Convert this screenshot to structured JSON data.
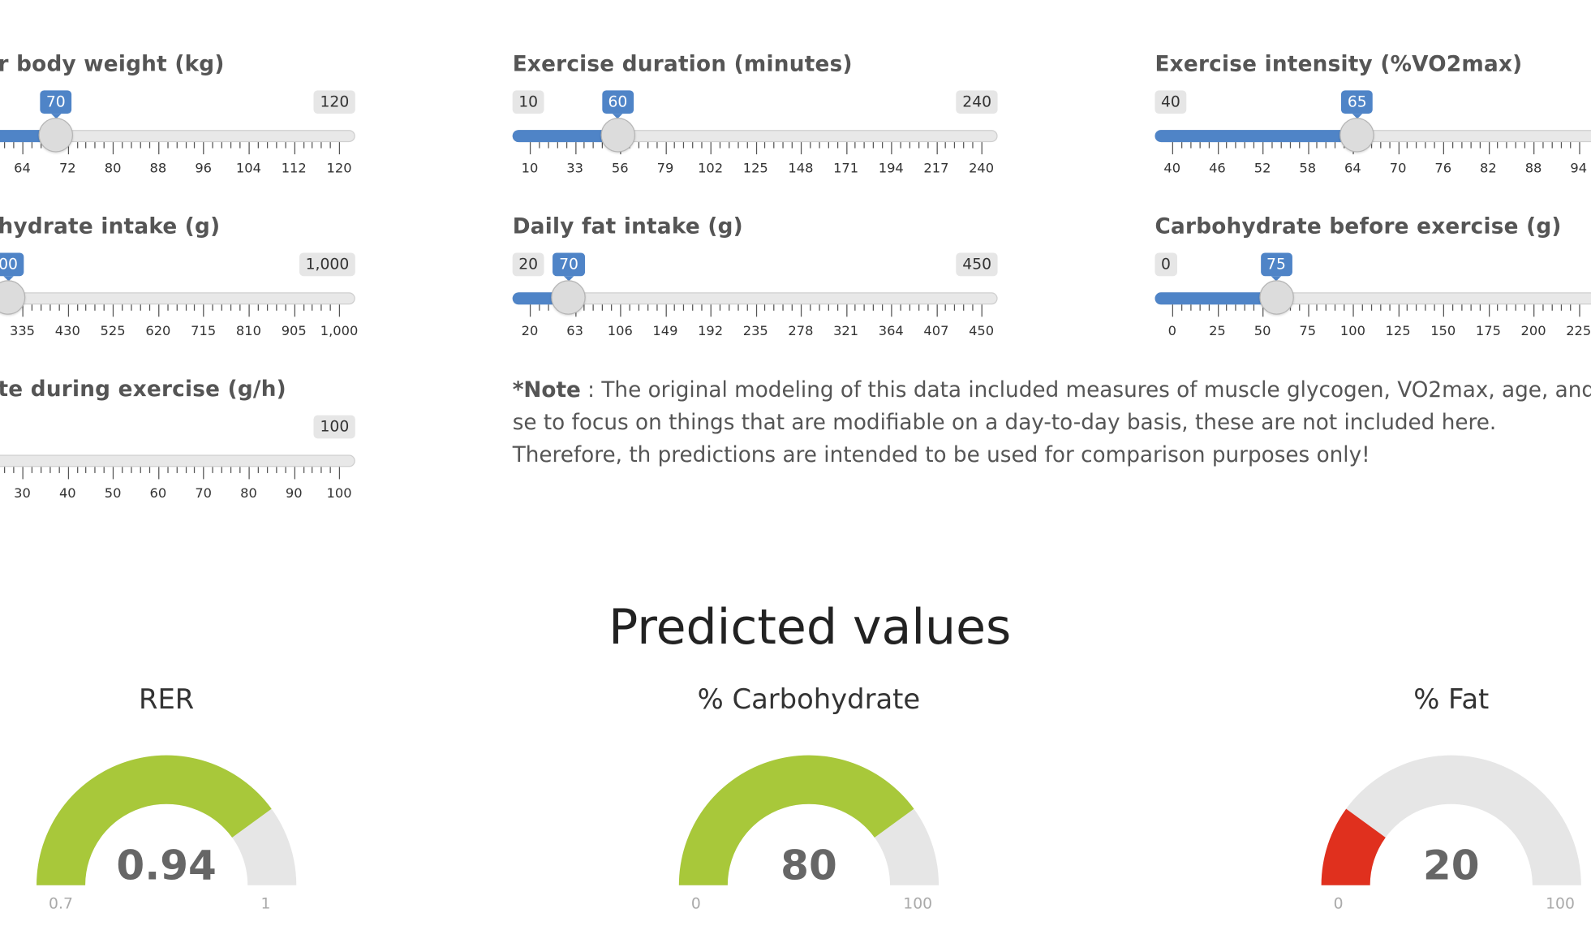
{
  "sliders": [
    {
      "id": "body-weight",
      "label": "r body weight (kg)",
      "min_label": "",
      "max_label": "120",
      "value_label": "70",
      "value_fraction": 0.5,
      "ticks": [
        "64",
        "72",
        "80",
        "88",
        "96",
        "104",
        "112",
        "120"
      ]
    },
    {
      "id": "exercise-duration",
      "label": "Exercise duration (minutes)",
      "min_label": "10",
      "max_label": "240",
      "value_label": "60",
      "value_fraction": 0.217,
      "ticks": [
        "10",
        "33",
        "56",
        "79",
        "102",
        "125",
        "148",
        "171",
        "194",
        "217",
        "240"
      ]
    },
    {
      "id": "exercise-intensity",
      "label": "Exercise intensity (%VO2max)",
      "min_label": "40",
      "max_label": "",
      "value_label": "65",
      "value_fraction": 0.417,
      "ticks": [
        "40",
        "46",
        "52",
        "58",
        "64",
        "70",
        "76",
        "82",
        "88",
        "94"
      ]
    },
    {
      "id": "carbohydrate-intake",
      "label": "hydrate intake (g)",
      "min_label": "",
      "max_label": "1,000",
      "value_label": "00",
      "value_fraction": 0.2,
      "ticks": [
        "335",
        "430",
        "525",
        "620",
        "715",
        "810",
        "905",
        "1,000"
      ]
    },
    {
      "id": "fat-intake",
      "label": "Daily fat intake (g)",
      "min_label": "20",
      "max_label": "450",
      "value_label": "70",
      "value_fraction": 0.116,
      "ticks": [
        "20",
        "63",
        "106",
        "149",
        "192",
        "235",
        "278",
        "321",
        "364",
        "407",
        "450"
      ]
    },
    {
      "id": "carb-before-exercise",
      "label": "Carbohydrate before exercise (g)",
      "min_label": "0",
      "max_label": "",
      "value_label": "75",
      "value_fraction": 0.25,
      "ticks": [
        "0",
        "25",
        "50",
        "75",
        "100",
        "125",
        "150",
        "175",
        "200",
        "225"
      ]
    },
    {
      "id": "carb-during-exercise",
      "label": "te during exercise (g/h)",
      "min_label": "",
      "max_label": "100",
      "value_label": "",
      "value_fraction": 0,
      "ticks": [
        "30",
        "40",
        "50",
        "60",
        "70",
        "80",
        "90",
        "100"
      ]
    }
  ],
  "note": {
    "bold": "*Note",
    "text": " : The original modeling of this data included measures of muscle glycogen, VO2max, age, and se to focus on things that are modifiable on a day-to-day basis, these are not included here. Therefore, th predictions are intended to be used for comparison purposes only!"
  },
  "predicted": {
    "title": "Predicted values",
    "gauges": [
      {
        "id": "rer",
        "title": "RER",
        "value": "0.94",
        "min": "0.7",
        "max": "1",
        "fraction": 0.8,
        "color": "#a8c83a"
      },
      {
        "id": "carbohydrate",
        "title": "% Carbohydrate",
        "value": "80",
        "min": "0",
        "max": "100",
        "fraction": 0.8,
        "color": "#a8c83a"
      },
      {
        "id": "fat",
        "title": "% Fat",
        "value": "20",
        "min": "0",
        "max": "100",
        "fraction": 0.2,
        "color": "#e0301e"
      }
    ]
  }
}
